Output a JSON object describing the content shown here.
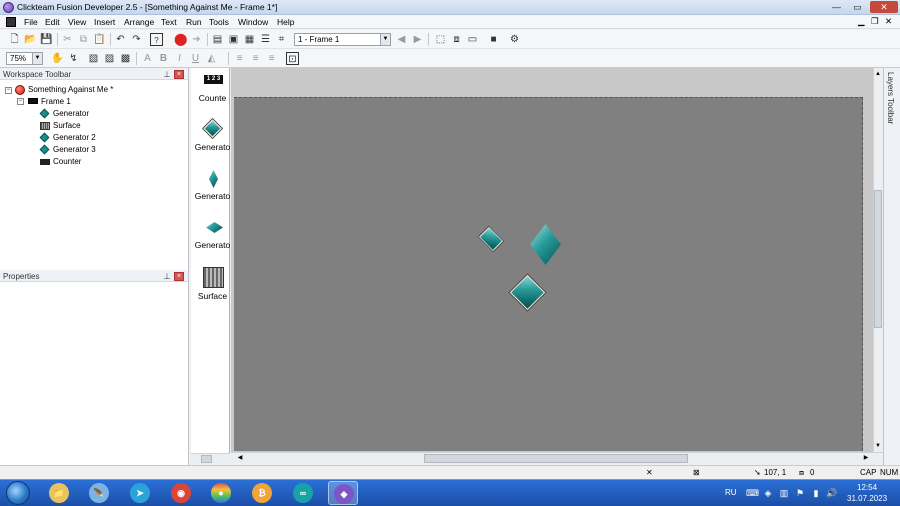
{
  "window": {
    "title": "Clickteam Fusion Developer 2.5 - [Something Against Me - Frame 1*]",
    "controls": {
      "minimize": "—",
      "maximize": "▭",
      "close": "✕",
      "inner_minimize": "▁",
      "inner_restore": "❐",
      "inner_close": "✕"
    }
  },
  "menu": [
    "File",
    "Edit",
    "View",
    "Insert",
    "Arrange",
    "Text",
    "Run",
    "Tools",
    "Window",
    "Help"
  ],
  "toolbar": {
    "frame_select": "1 - Frame 1",
    "zoom": "75%"
  },
  "workspace": {
    "title": "Workspace Toolbar",
    "app_name": "Something Against Me *",
    "frame_name": "Frame 1",
    "objects": [
      {
        "label": "Generator",
        "icon": "diamond-icon"
      },
      {
        "label": "Surface",
        "icon": "surface-icon"
      },
      {
        "label": "Generator 2",
        "icon": "diamond-icon"
      },
      {
        "label": "Generator 3",
        "icon": "diamond-icon"
      },
      {
        "label": "Counter",
        "icon": "counter-icon"
      }
    ]
  },
  "properties": {
    "title": "Properties"
  },
  "object_strip": {
    "items": [
      {
        "label": "Counte",
        "icon": "counter-icon",
        "glyph": "1 2 3"
      },
      {
        "label": "Generato",
        "icon": "diamond-icon"
      },
      {
        "label": "Generato",
        "icon": "diamond-icon"
      },
      {
        "label": "Generato",
        "icon": "diamond-icon"
      },
      {
        "label": "Surface",
        "icon": "surface-icon"
      }
    ]
  },
  "layers": {
    "title": "Layers Toolbar"
  },
  "status": {
    "coords": "107, 1",
    "objects": "0",
    "caps": "CAP",
    "num": "NUM"
  },
  "taskbar": {
    "language": "RU",
    "time": "12:54",
    "date": "31.07.2023",
    "apps": [
      {
        "name": "explorer",
        "glyph": "📁",
        "color": "#e8c25a"
      },
      {
        "name": "pinned-app",
        "glyph": "🪶",
        "color": "#7ab3e6"
      },
      {
        "name": "telegram",
        "glyph": "➤",
        "color": "#2aa3dc"
      },
      {
        "name": "chrome",
        "glyph": "◉",
        "color": "#db4437"
      },
      {
        "name": "multicolor-app",
        "glyph": "●",
        "color": "#e94e9a"
      },
      {
        "name": "bitcoin",
        "glyph": "₿",
        "color": "#f2a33a"
      },
      {
        "name": "arduino",
        "glyph": "∞",
        "color": "#18a2a7"
      },
      {
        "name": "clickteam",
        "glyph": "◈",
        "color": "#7d55c7"
      }
    ]
  }
}
